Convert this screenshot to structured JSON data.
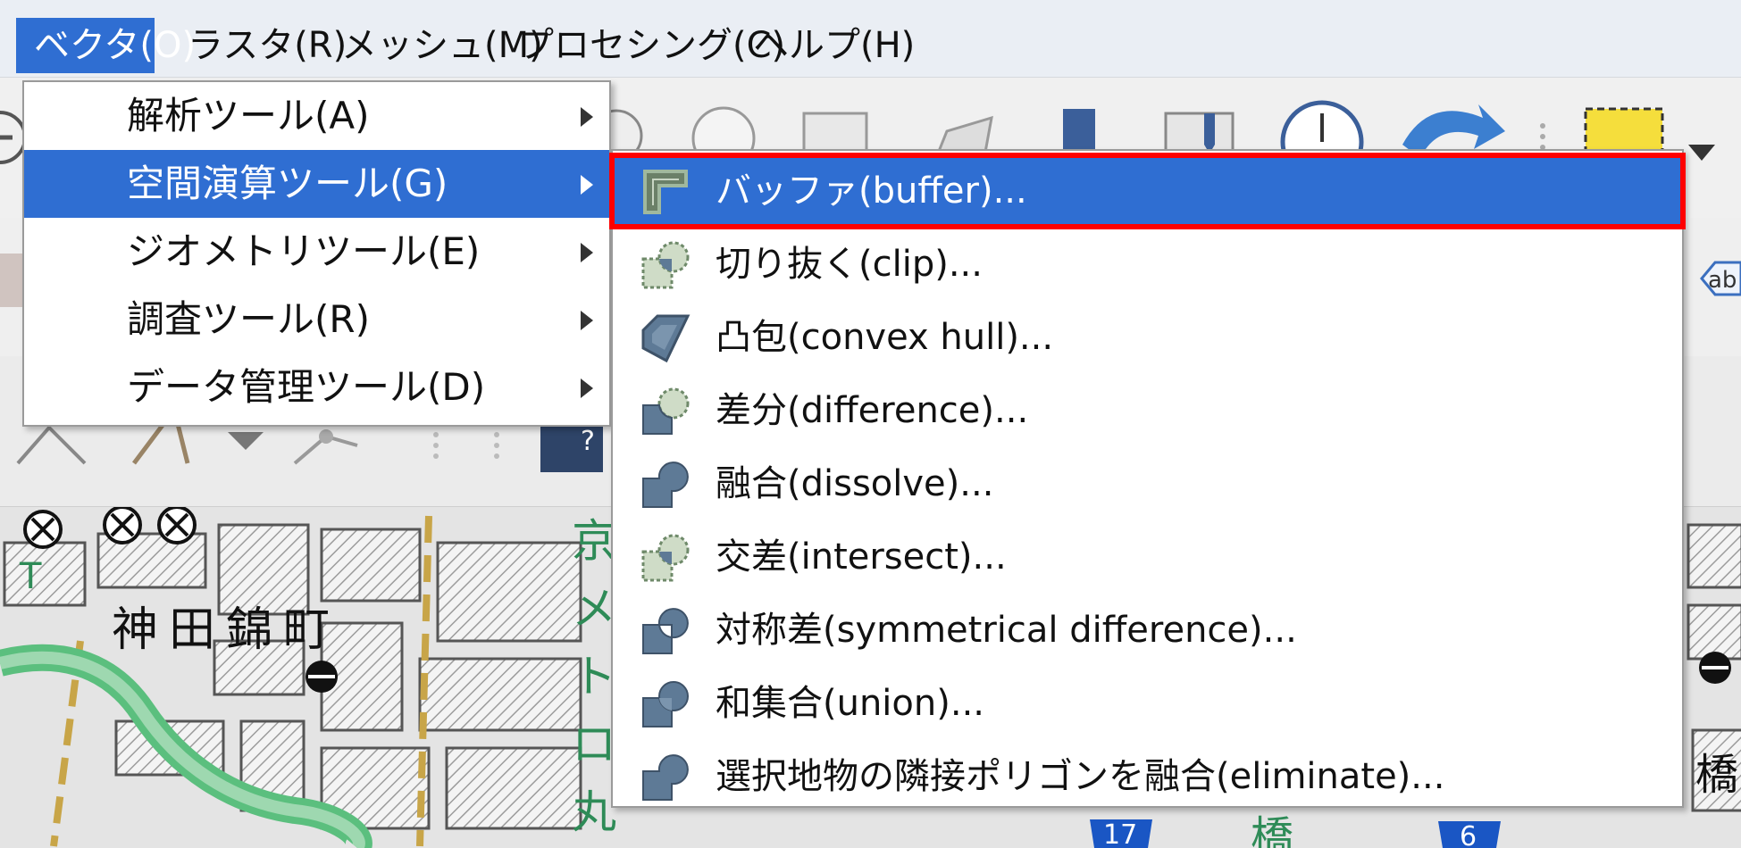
{
  "menubar": {
    "items": [
      {
        "label": "ベクタ(O)",
        "active": true
      },
      {
        "label": "ラスタ(R)",
        "active": false
      },
      {
        "label": "メッシュ(M)",
        "active": false
      },
      {
        "label": "プロセシング(C)",
        "active": false
      },
      {
        "label": "ヘルプ(H)",
        "active": false
      }
    ]
  },
  "vector_menu": {
    "items": [
      {
        "label": "解析ツール(A)"
      },
      {
        "label": "空間演算ツール(G)"
      },
      {
        "label": "ジオメトリツール(E)"
      },
      {
        "label": "調査ツール(R)"
      },
      {
        "label": "データ管理ツール(D)"
      }
    ]
  },
  "geoprocessing_menu": {
    "items": [
      {
        "label": "バッファ(buffer)...",
        "icon": "buffer-icon"
      },
      {
        "label": "切り抜く(clip)...",
        "icon": "clip-icon"
      },
      {
        "label": "凸包(convex hull)...",
        "icon": "convex-hull-icon"
      },
      {
        "label": "差分(difference)...",
        "icon": "difference-icon"
      },
      {
        "label": "融合(dissolve)...",
        "icon": "dissolve-icon"
      },
      {
        "label": "交差(intersect)...",
        "icon": "intersect-icon"
      },
      {
        "label": "対称差(symmetrical difference)...",
        "icon": "symmetrical-difference-icon"
      },
      {
        "label": "和集合(union)...",
        "icon": "union-icon"
      },
      {
        "label": "選択地物の隣接ポリゴンを融合(eliminate)...",
        "icon": "eliminate-icon"
      }
    ]
  },
  "toolbar": {
    "label_badge": "ab",
    "help_badge": "?"
  },
  "map": {
    "place_label": "神田錦町",
    "right_label": "橋",
    "bottom_label": "橋",
    "left_label": "T",
    "route_17": "17",
    "route_6": "6",
    "vertical_chars": [
      "京",
      "メ",
      "ト",
      "ロ",
      "丸"
    ]
  },
  "colors": {
    "accent": "#2f6ed2",
    "highlight": "#ff0000",
    "icon_fill": "#5e7a96",
    "icon_dashed_fill": "#cfdcc7"
  }
}
